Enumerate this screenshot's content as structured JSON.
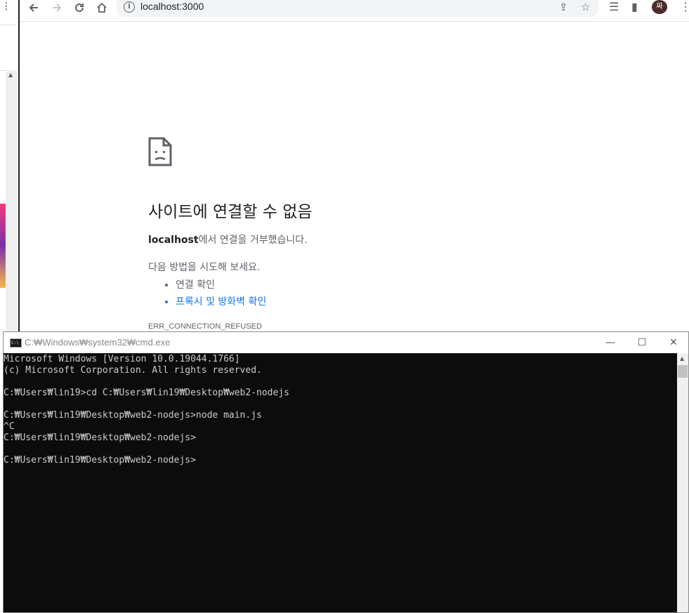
{
  "browser": {
    "url": "localhost:3000",
    "avatar_text": "짜",
    "icons": [
      "back-icon",
      "forward-icon",
      "reload-icon",
      "home-icon",
      "info-icon",
      "share-icon",
      "star-icon",
      "reading-list-icon",
      "side-panel-icon",
      "menu-icon"
    ]
  },
  "error_page": {
    "title": "사이트에 연결할 수 없음",
    "host": "localhost",
    "message_suffix": "에서 연결을 거부했습니다.",
    "try_label": "다음 방법을 시도해 보세요.",
    "suggestions": [
      "연결 확인",
      "프록시 및 방화벽 확인"
    ],
    "error_code": "ERR_CONNECTION_REFUSED"
  },
  "cmd": {
    "title": "C:₩Windows₩system32₩cmd.exe",
    "lines": [
      "Microsoft Windows [Version 10.0.19044.1766]",
      "(c) Microsoft Corporation. All rights reserved.",
      "",
      "C:₩Users₩lin19>cd C:₩Users₩lin19₩Desktop₩web2-nodejs",
      "",
      "C:₩Users₩lin19₩Desktop₩web2-nodejs>node main.js",
      "^C",
      "C:₩Users₩lin19₩Desktop₩web2-nodejs>",
      "",
      "C:₩Users₩lin19₩Desktop₩web2-nodejs>"
    ]
  },
  "colors": {
    "link": "#1a73e8",
    "console_bg": "#0c0c0c",
    "console_text": "#cccccc"
  }
}
